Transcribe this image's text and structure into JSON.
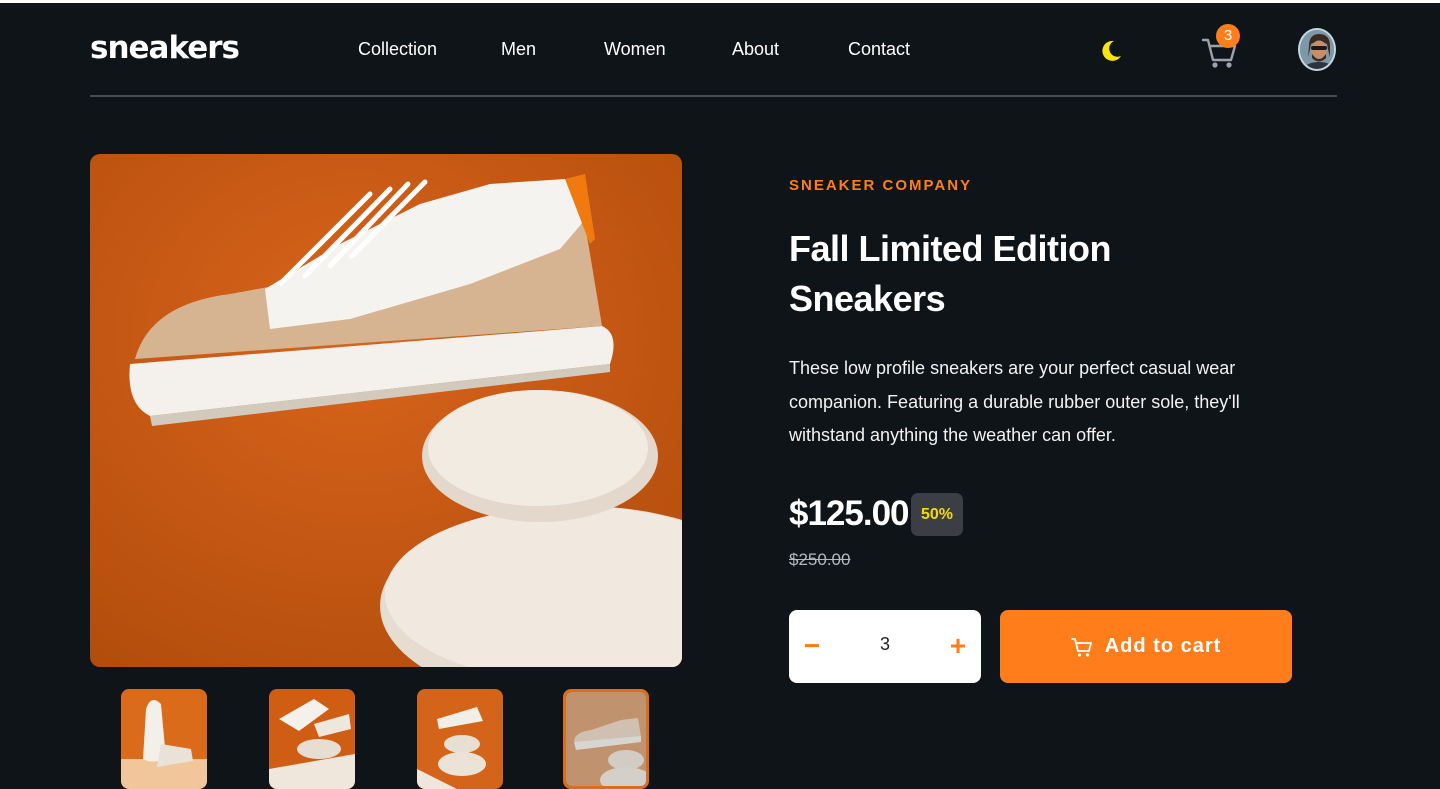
{
  "header": {
    "logo": "sneakers",
    "nav": [
      "Collection",
      "Men",
      "Women",
      "About",
      "Contact"
    ],
    "cart_count": "3",
    "icons": {
      "theme": "moon-icon",
      "cart": "cart-icon",
      "avatar": "user-avatar"
    }
  },
  "gallery": {
    "main_image": "sneaker-on-stones-photo",
    "thumbnails": [
      "thumbnail-1",
      "thumbnail-2",
      "thumbnail-3",
      "thumbnail-4"
    ],
    "active_thumbnail": 4
  },
  "product": {
    "company": "SNEAKER COMPANY",
    "title": "Fall Limited Edition Sneakers",
    "description": "These low profile sneakers are your perfect casual wear companion. Featuring a durable rubber outer sole, they'll withstand anything the weather can offer.",
    "price": "$125.00",
    "discount": "50%",
    "old_price": "$250.00"
  },
  "cart_form": {
    "minus": "−",
    "plus": "+",
    "quantity": "3",
    "add_label": "Add to cart"
  },
  "colors": {
    "accent": "#ff7e1b",
    "background": "#0f1419",
    "discount_text": "#f5d90a",
    "discount_bg": "#3b3f45"
  }
}
